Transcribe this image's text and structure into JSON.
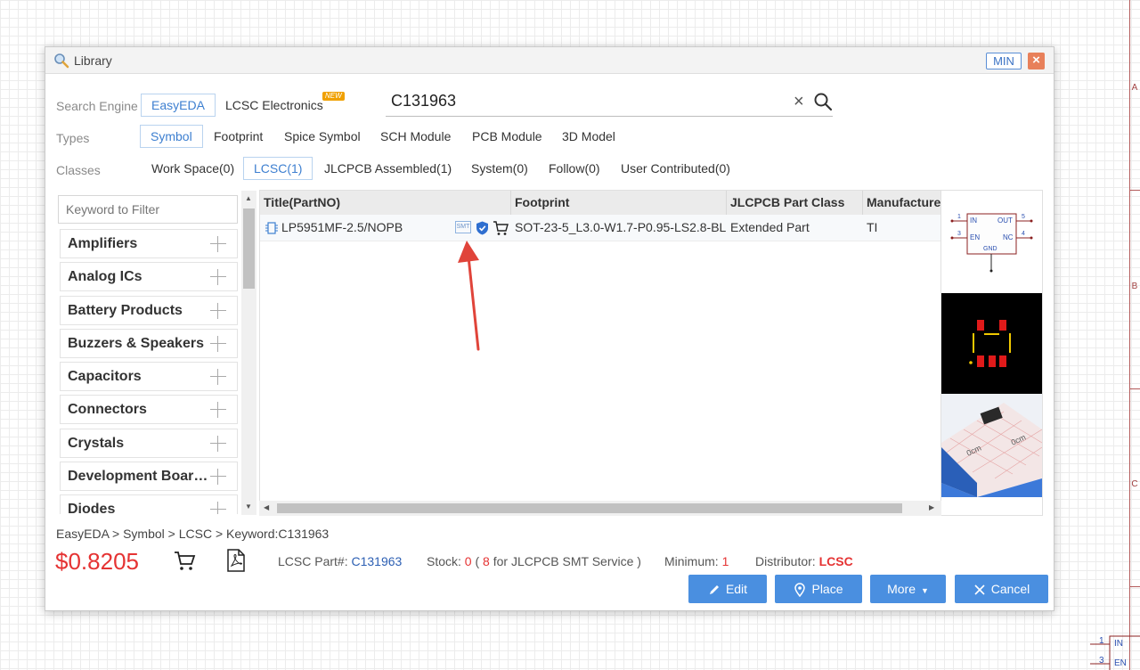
{
  "dialog": {
    "title": "Library",
    "min_label": "MIN",
    "close_label": "×"
  },
  "search": {
    "engine_label": "Search Engine",
    "engines": [
      {
        "label": "EasyEDA",
        "active": true
      },
      {
        "label": "LCSC Electronics",
        "active": false
      }
    ],
    "new_badge": "NEW",
    "query": "C131963",
    "clear_label": "×"
  },
  "types": {
    "label": "Types",
    "items": [
      "Symbol",
      "Footprint",
      "Spice Symbol",
      "SCH Module",
      "PCB Module",
      "3D Model"
    ]
  },
  "classes": {
    "label": "Classes",
    "items": [
      "Work Space(0)",
      "LCSC(1)",
      "JLCPCB Assembled(1)",
      "System(0)",
      "Follow(0)",
      "User Contributed(0)"
    ]
  },
  "filter": {
    "placeholder": "Keyword to Filter"
  },
  "categories": [
    "Amplifiers",
    "Analog ICs",
    "Battery Products",
    "Buzzers & Speakers",
    "Capacitors",
    "Connectors",
    "Crystals",
    "Development Boards",
    "Diodes"
  ],
  "table": {
    "columns": [
      "Title(PartNO)",
      "Footprint",
      "JLCPCB Part Class",
      "Manufacturer"
    ],
    "rows": [
      {
        "title": "LP5951MF-2.5/NOPB",
        "smt": "SMT",
        "footprint": "SOT-23-5_L3.0-W1.7-P0.95-LS2.8-BL",
        "part_class": "Extended Part",
        "manufacturer": "TI"
      }
    ]
  },
  "preview": {
    "pins": {
      "in": "IN",
      "en": "EN",
      "out": "OUT",
      "nc": "NC",
      "gnd": "GND",
      "p1": "1",
      "p3": "3",
      "p5": "5",
      "p4": "4"
    }
  },
  "footer": {
    "breadcrumb": "EasyEDA > Symbol > LCSC > Keyword:C131963",
    "price": "$0.8205",
    "lcsc_label": "LCSC Part#:",
    "lcsc_part": "C131963",
    "stock_label": "Stock:",
    "stock_value": "0",
    "stock_paren_open": "(",
    "stock_smt_count": "8",
    "stock_smt_text": "for JLCPCB SMT Service )",
    "minimum_label": "Minimum:",
    "minimum_value": "1",
    "distributor_label": "Distributor:",
    "distributor_value": "LCSC"
  },
  "buttons": {
    "edit": "Edit",
    "place": "Place",
    "more": "More",
    "cancel": "Cancel"
  },
  "schematic": {
    "letters": [
      "A",
      "B",
      "C"
    ],
    "pin1": "1",
    "pin1_label": "IN",
    "pin3": "3",
    "pin3_label": "EN"
  },
  "colors": {
    "accent": "#4a8fe0",
    "price": "#e53333",
    "link": "#2c5fb3",
    "annotation_arrow": "#e0443a"
  }
}
